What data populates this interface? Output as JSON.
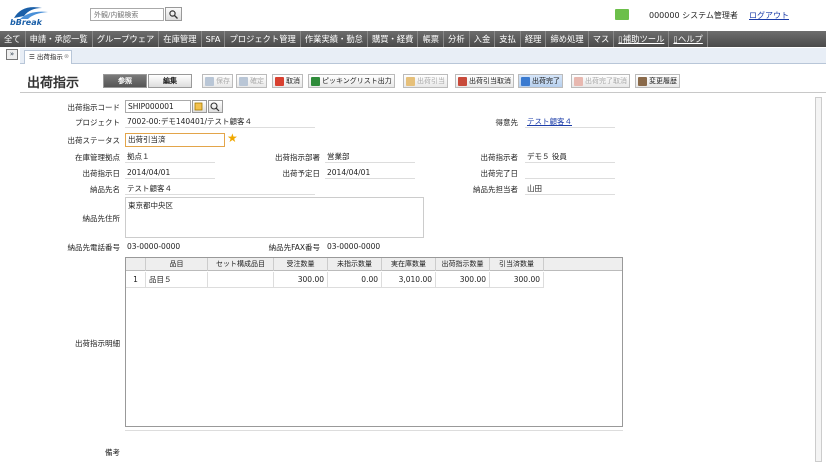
{
  "header": {
    "logo_text": "bBreak",
    "search_placeholder": "外観/内観検索",
    "user": "000000 システム管理者",
    "logout": "ログアウト"
  },
  "menu": [
    "全て",
    "申請・承認一覧",
    "グループウェア",
    "在庫管理",
    "SFA",
    "プロジェクト管理",
    "作業実績・勤怠",
    "購買・経費",
    "帳票",
    "分析",
    "入金",
    "支払",
    "経理",
    "締め処理",
    "マス"
  ],
  "menu_right": [
    "補助ツール",
    "ヘルプ"
  ],
  "tab": {
    "label": "出荷指示"
  },
  "page": {
    "title": "出荷指示",
    "mode_ref": "参照",
    "mode_edit": "編集"
  },
  "toolbar": [
    "保存",
    "確定",
    "取消",
    "ピッキングリスト出力",
    "出荷引当",
    "出荷引当取消",
    "出荷完了",
    "出荷完了取消",
    "変更履歴"
  ],
  "form": {
    "code_label": "出荷指示コード",
    "code": "SHIP000001",
    "project_label": "プロジェクト",
    "project": "7002-00:デモ140401/テスト顧客４",
    "dest_label": "得意先",
    "dest": "テスト顧客４",
    "status_label": "出荷ステータス",
    "status": "出荷引当済",
    "base_label": "在庫管理拠点",
    "base": "拠点１",
    "dept_label": "出荷指示部署",
    "dept": "営業部",
    "person_label": "出荷指示者",
    "person": "デモ５ 役員",
    "date_label": "出荷指示日",
    "date": "2014/04/01",
    "plan_label": "出荷予定日",
    "plan": "2014/04/01",
    "done_label": "出荷完了日",
    "done": "",
    "deliv_label": "納品先名",
    "deliv": "テスト顧客４",
    "deliv_person_label": "納品先担当者",
    "deliv_person": "山田",
    "addr_label": "納品先住所",
    "addr": "東京都中央区",
    "tel_label": "納品先電話番号",
    "tel": "03-0000-0000",
    "fax_label": "納品先FAX番号",
    "fax": "03-0000-0000",
    "detail_label": "出荷指示明細",
    "memo_label": "備考"
  },
  "grid": {
    "headers": [
      "品目",
      "セット構成品目",
      "受注数量",
      "未指示数量",
      "実在庫数量",
      "出荷指示数量",
      "引当済数量"
    ],
    "rows": [
      {
        "no": "1",
        "item": "品目５",
        "set": "",
        "order": "300.00",
        "remain": "0.00",
        "stock": "3,010.00",
        "ship": "300.00",
        "alloc": "300.00"
      }
    ]
  }
}
